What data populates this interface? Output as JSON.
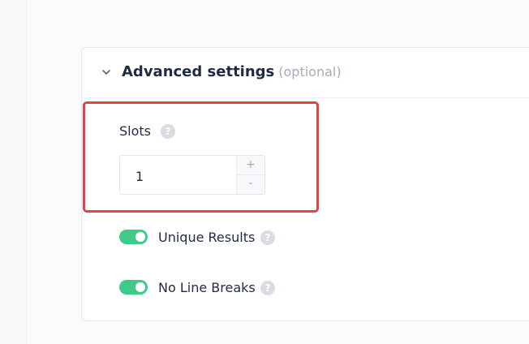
{
  "advanced": {
    "title": "Advanced settings",
    "optional": "(optional)"
  },
  "slots": {
    "label": "Slots",
    "value": "1",
    "increment": "+",
    "decrement": "-"
  },
  "toggles": [
    {
      "label": "Unique Results",
      "enabled": true
    },
    {
      "label": "No Line Breaks",
      "enabled": true
    }
  ],
  "help_glyph": "?",
  "colors": {
    "accent_green": "#3ecb8a",
    "highlight_red": "#d94848",
    "text_dark": "#1f2a44",
    "muted": "#a6adb8"
  }
}
